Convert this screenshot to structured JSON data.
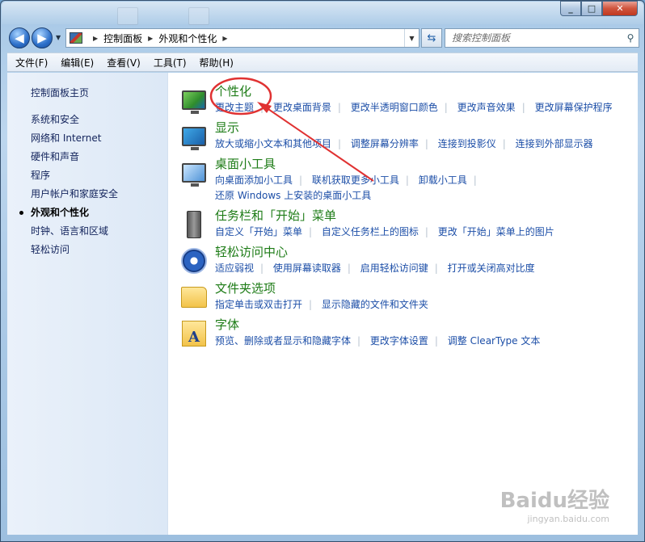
{
  "window": {
    "minimize": "_",
    "maximize": "□",
    "close": "✕"
  },
  "nav": {
    "back": "◀",
    "forward": "▶"
  },
  "address": {
    "crumbs": [
      "控制面板",
      "外观和个性化"
    ]
  },
  "search": {
    "placeholder": "搜索控制面板"
  },
  "menu": [
    "文件(F)",
    "编辑(E)",
    "查看(V)",
    "工具(T)",
    "帮助(H)"
  ],
  "sidebar": {
    "home": "控制面板主页",
    "items": [
      "系统和安全",
      "网络和 Internet",
      "硬件和声音",
      "程序",
      "用户帐户和家庭安全",
      "外观和个性化",
      "时钟、语言和区域",
      "轻松访问"
    ],
    "active_index": 5
  },
  "categories": [
    {
      "title": "个性化",
      "icon": "personalization-icon",
      "links": [
        "更改主题",
        "更改桌面背景",
        "更改半透明窗口颜色",
        "更改声音效果",
        "更改屏幕保护程序"
      ]
    },
    {
      "title": "显示",
      "icon": "display-icon",
      "links": [
        "放大或缩小文本和其他项目",
        "调整屏幕分辨率",
        "连接到投影仪",
        "连接到外部显示器"
      ]
    },
    {
      "title": "桌面小工具",
      "icon": "gadgets-icon",
      "links": [
        "向桌面添加小工具",
        "联机获取更多小工具",
        "卸载小工具",
        "还原 Windows 上安装的桌面小工具"
      ]
    },
    {
      "title": "任务栏和「开始」菜单",
      "icon": "taskbar-icon",
      "links": [
        "自定义「开始」菜单",
        "自定义任务栏上的图标",
        "更改「开始」菜单上的图片"
      ]
    },
    {
      "title": "轻松访问中心",
      "icon": "ease-of-access-icon",
      "links": [
        "适应弱视",
        "使用屏幕读取器",
        "启用轻松访问键",
        "打开或关闭高对比度"
      ]
    },
    {
      "title": "文件夹选项",
      "icon": "folder-options-icon",
      "links": [
        "指定单击或双击打开",
        "显示隐藏的文件和文件夹"
      ]
    },
    {
      "title": "字体",
      "icon": "fonts-icon",
      "links": [
        "预览、删除或者显示和隐藏字体",
        "更改字体设置",
        "调整 ClearType 文本"
      ]
    }
  ],
  "watermark": {
    "main": "Baidu经验",
    "sub": "jingyan.baidu.com"
  },
  "colors": {
    "link": "#1c4ea7",
    "category_title": "#1e7c17",
    "annotation": "#e03232"
  }
}
